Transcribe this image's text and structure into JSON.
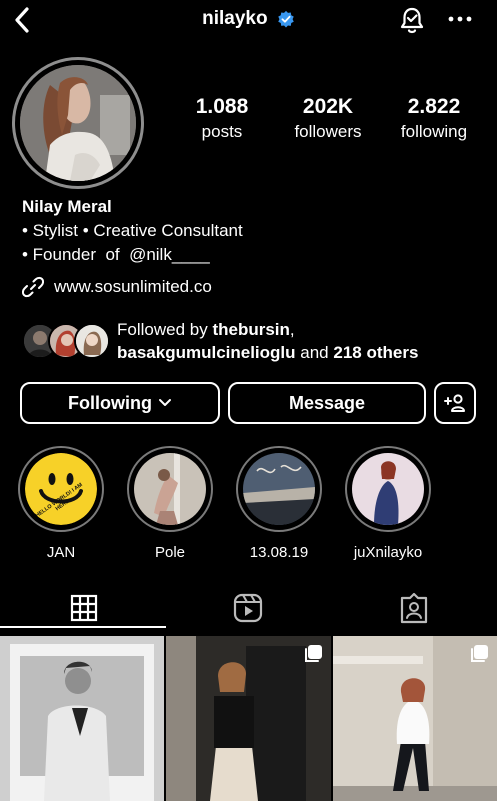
{
  "header": {
    "username": "nilayko",
    "back_icon": "chevron-left-icon",
    "verified_icon": "verified-badge-icon",
    "bell_icon": "notification-bell-icon",
    "more_icon": "more-horizontal-icon"
  },
  "stats": [
    {
      "value": "1.088",
      "label": "posts"
    },
    {
      "value": "202K",
      "label": "followers"
    },
    {
      "value": "2.822",
      "label": "following"
    }
  ],
  "bio": {
    "name": "Nilay Meral",
    "line1": "• Stylist • Creative Consultant",
    "line2": "• Founder  of  @nilk____",
    "link": "www.sosunlimited.co"
  },
  "followed_by": {
    "prefix": "Followed by ",
    "user1": "thebursin",
    "sep": ",",
    "user2": "basakgumulcinelioglu",
    "mid": " and ",
    "others": "218 others"
  },
  "buttons": {
    "following": "Following",
    "message": "Message"
  },
  "highlights": [
    {
      "label": "JAN",
      "text": "HELLO WORLD! I AM HERE"
    },
    {
      "label": "Pole"
    },
    {
      "label": "13.08.19"
    },
    {
      "label": "juXnilayko"
    }
  ],
  "tabs": [
    "grid-icon",
    "reels-icon",
    "tagged-icon"
  ],
  "colors": {
    "background": "#000000",
    "verified": "#3897f0",
    "smiley": "#f7d128"
  }
}
